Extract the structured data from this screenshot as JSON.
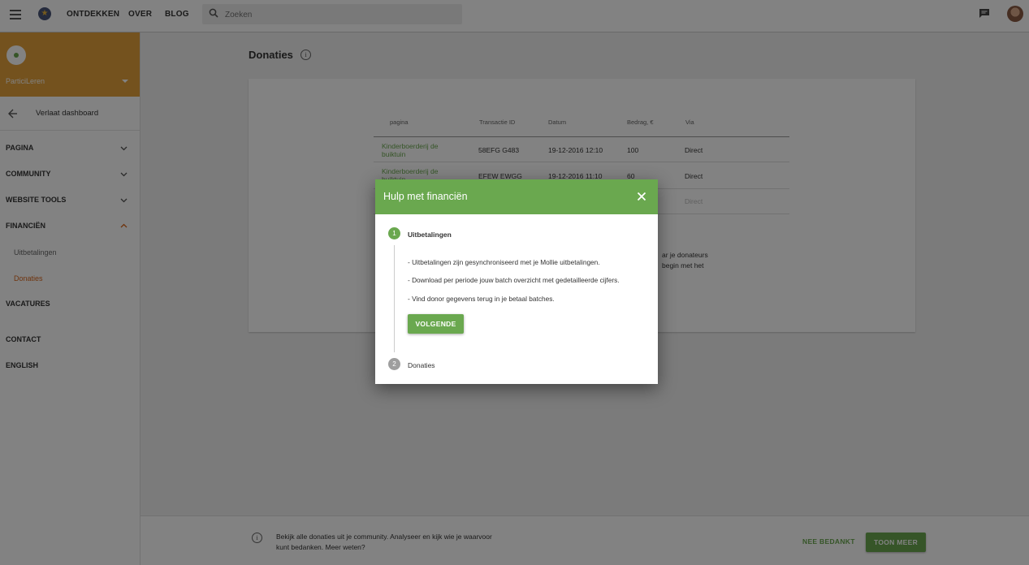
{
  "topbar": {
    "nav": [
      "ONTDEKKEN",
      "OVER",
      "BLOG"
    ],
    "search_placeholder": "Zoeken"
  },
  "sidebar": {
    "org_name": "ParticiLeren",
    "back_label": "Verlaat dashboard",
    "items": [
      {
        "label": "PAGINA",
        "expandable": true,
        "expanded": false
      },
      {
        "label": "COMMUNITY",
        "expandable": true,
        "expanded": false
      },
      {
        "label": "WEBSITE TOOLS",
        "expandable": true,
        "expanded": false
      },
      {
        "label": "FINANCIËN",
        "expandable": true,
        "expanded": true
      },
      {
        "label": "VACATURES"
      },
      {
        "label": "CONTACT"
      },
      {
        "label": "ENGLISH"
      }
    ],
    "subitems": [
      {
        "label": "Uitbetalingen",
        "active": false
      },
      {
        "label": "Donaties",
        "active": true
      }
    ]
  },
  "main": {
    "title": "Donaties",
    "table": {
      "headers": [
        "pagina",
        "Transactie ID",
        "Datum",
        "Bedrag, €",
        "Via"
      ],
      "rows": [
        [
          "Kinderboerderij de buiktuin",
          "58EFG G483",
          "19-12-2016 12:10",
          "100",
          "Direct"
        ],
        [
          "Kinderboerderij de buiktuin",
          "EFEW EWGG",
          "19-12-2016 11:10",
          "60",
          "Direct"
        ],
        [
          "",
          "",
          "",
          "",
          "Direct"
        ]
      ]
    },
    "side_note_lines": [
      "ar je donateurs",
      "begin met het"
    ]
  },
  "banner": {
    "text": "Bekijk alle donaties uit je community. Analyseer en kijk wie je waarvoor kunt bedanken. Meer weten?",
    "dismiss_label": "NEE BEDANKT",
    "more_label": "TOON MEER"
  },
  "dialog": {
    "title": "Hulp met financiën",
    "steps": [
      {
        "number": "1",
        "title": "Uitbetalingen",
        "lines": [
          "- Uitbetalingen zijn gesynchroniseerd met je Mollie uitbetalingen.",
          "- Download per periode jouw batch overzicht met gedetailleerde cijfers.",
          "- Vind donor gegevens terug in je betaal batches."
        ],
        "button": "VOLGENDE"
      },
      {
        "number": "2",
        "title": "Donaties"
      }
    ]
  },
  "colors": {
    "accent_green": "#6aa84f",
    "header_orange": "#e4a13b",
    "active_orange": "#d9651a"
  }
}
